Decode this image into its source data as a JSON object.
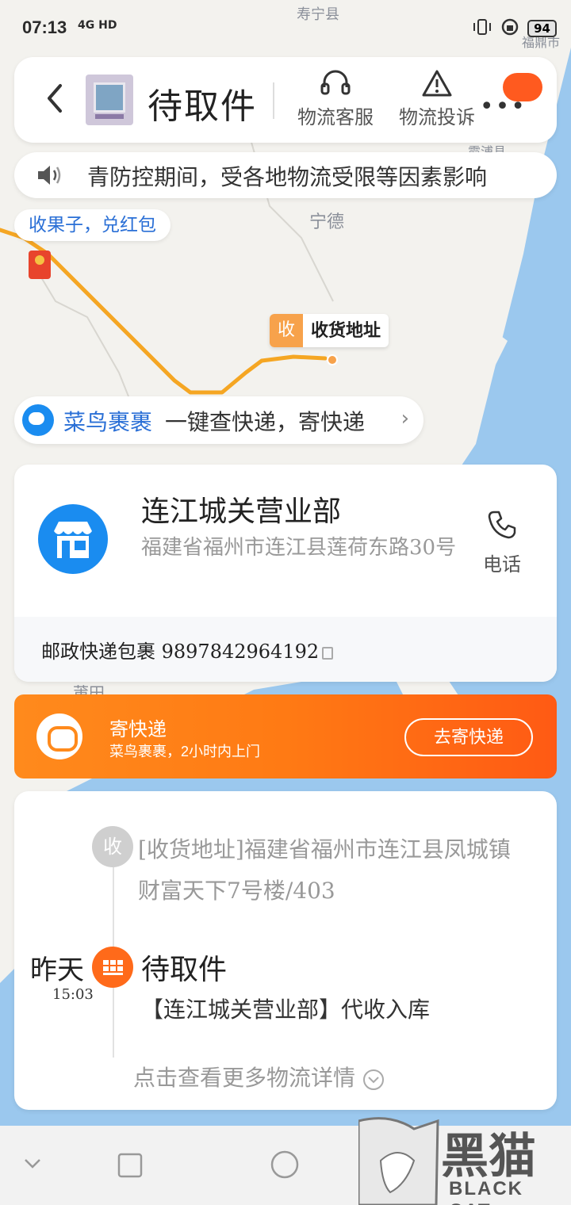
{
  "status_bar": {
    "time": "07:13",
    "network": "4G HD",
    "battery": "94"
  },
  "map": {
    "labels": [
      "寿宁县",
      "福鼎市",
      "霞浦县",
      "宁德",
      "莆田"
    ]
  },
  "header": {
    "title": "待取件",
    "actions": [
      {
        "label": "物流客服",
        "icon": "headset-icon"
      },
      {
        "label": "物流投诉",
        "icon": "warning-icon"
      }
    ]
  },
  "notice": {
    "text": "青防控期间，受各地物流受限等因素影响"
  },
  "red_packet": {
    "label": "收果子，兑红包"
  },
  "map_marker": {
    "tag": "收",
    "label": "收货地址"
  },
  "cainiao": {
    "brand": "菜鸟裹裹",
    "slogan": "一键查快递，寄快递"
  },
  "station": {
    "name": "连江城关营业部",
    "address": "福建省福州市连江县莲荷东路30号",
    "phone_label": "电话",
    "tracking": "邮政快递包裹 9897842964192"
  },
  "send_express": {
    "title": "寄快递",
    "subtitle": "菜鸟裹裹，2小时内上门",
    "button": "去寄快递"
  },
  "timeline": {
    "receive_tag": "收",
    "receive_address": "[收货地址]福建省福州市连江县凤城镇 财富天下7号楼/403",
    "day": "昨天",
    "time": "15:03",
    "status": "待取件",
    "description": "【连江城关营业部】代收入库",
    "more": "点击查看更多物流详情"
  },
  "watermark": {
    "text": "黑猫",
    "sub": "BLACK CAT"
  },
  "colors": {
    "accent_orange": "#ff6a1a",
    "link_blue": "#2a6fd6",
    "cainiao_blue": "#1a8cf0",
    "route_orange": "#f5a623"
  }
}
